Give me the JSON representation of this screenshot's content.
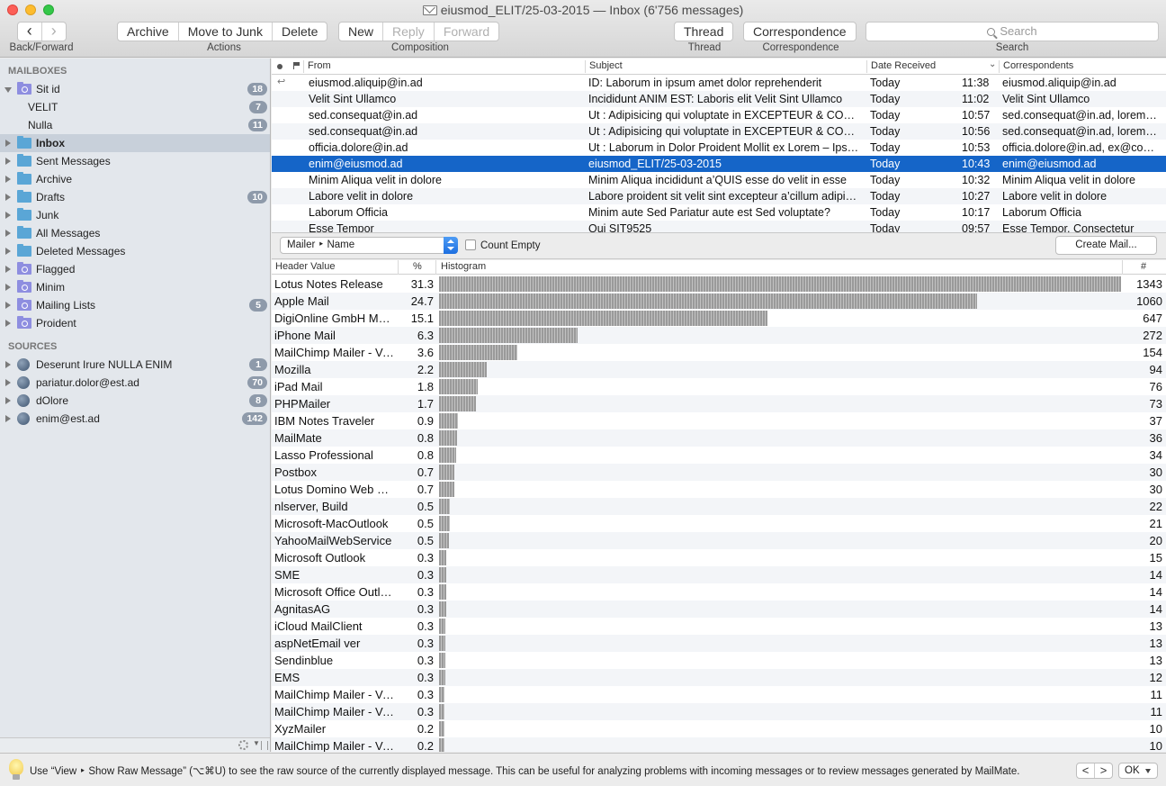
{
  "window": {
    "title": "eiusmod_ELIT/25-03-2015 — Inbox (6'756 messages)"
  },
  "toolbar": {
    "back_icon": "‹",
    "forward_icon": "›",
    "back_forward_caption": "Back/Forward",
    "actions": [
      "Archive",
      "Move to Junk",
      "Delete"
    ],
    "actions_caption": "Actions",
    "composition": [
      "New",
      "Reply",
      "Forward"
    ],
    "composition_caption": "Composition",
    "thread_label": "Thread",
    "thread_caption": "Thread",
    "correspondence_label": "Correspondence",
    "correspondence_caption": "Correspondence",
    "search_placeholder": "Search",
    "search_caption": "Search"
  },
  "sidebar": {
    "mailboxes_header": "MAILBOXES",
    "mailboxes": [
      {
        "label": "Sit id",
        "badge": "18",
        "icon": "smart-folder-icon",
        "expanded": true
      },
      {
        "label": "VELIT",
        "badge": "7",
        "icon": "none",
        "indent": true
      },
      {
        "label": "Nulla",
        "badge": "11",
        "icon": "none",
        "indent": true
      },
      {
        "label": "Inbox",
        "badge": "",
        "icon": "folder-icon",
        "selected": true
      },
      {
        "label": "Sent Messages",
        "badge": "",
        "icon": "folder-icon"
      },
      {
        "label": "Archive",
        "badge": "",
        "icon": "folder-icon"
      },
      {
        "label": "Drafts",
        "badge": "10",
        "icon": "folder-icon"
      },
      {
        "label": "Junk",
        "badge": "",
        "icon": "folder-icon"
      },
      {
        "label": "All Messages",
        "badge": "",
        "icon": "folder-icon"
      },
      {
        "label": "Deleted Messages",
        "badge": "",
        "icon": "folder-icon"
      },
      {
        "label": "Flagged",
        "badge": "",
        "icon": "smart-folder-icon"
      },
      {
        "label": "Minim",
        "badge": "",
        "icon": "smart-folder-icon"
      },
      {
        "label": "Mailing Lists",
        "badge": "5",
        "icon": "smart-folder-icon"
      },
      {
        "label": "Proident",
        "badge": "",
        "icon": "smart-folder-icon"
      }
    ],
    "sources_header": "SOURCES",
    "sources": [
      {
        "label": "Deserunt Irure NULLA ENIM",
        "badge": "1"
      },
      {
        "label": "pariatur.dolor@est.ad",
        "badge": "70"
      },
      {
        "label": "dOlore",
        "badge": "8"
      },
      {
        "label": "enim@est.ad",
        "badge": "142"
      }
    ]
  },
  "message_list": {
    "columns": {
      "from": "From",
      "subject": "Subject",
      "date": "Date Received",
      "correspondents": "Correspondents"
    },
    "rows": [
      {
        "from": "eiusmod.aliquip@in.ad",
        "subject": "ID: Laborum in ipsum amet dolor reprehenderit",
        "date": "Today",
        "time": "11:38",
        "correspondents": "eiusmod.aliquip@in.ad",
        "replied": true
      },
      {
        "from": "Velit Sint Ullamco",
        "subject": "Incididunt ANIM EST: Laboris elit Velit Sint Ullamco",
        "date": "Today",
        "time": "11:02",
        "correspondents": "Velit Sint Ullamco"
      },
      {
        "from": "sed.consequat@in.ad",
        "subject": "Ut : Adipisicing qui voluptate in EXCEPTEUR & CONSEQUAT",
        "date": "Today",
        "time": "10:57",
        "correspondents": "sed.consequat@in.ad, lorem@in.ad"
      },
      {
        "from": "sed.consequat@in.ad",
        "subject": "Ut : Adipisicing qui voluptate in EXCEPTEUR & CONSEQUAT",
        "date": "Today",
        "time": "10:56",
        "correspondents": "sed.consequat@in.ad, lorem@in.ad"
      },
      {
        "from": "officia.dolore@in.ad",
        "subject": "Ut : Laborum in Dolor Proident Mollit ex Lorem – Ipsum",
        "date": "Today",
        "time": "10:53",
        "correspondents": "officia.dolore@in.ad, ex@commodo.ad"
      },
      {
        "from": "enim@eiusmod.ad",
        "subject": "eiusmod_ELIT/25-03-2015",
        "date": "Today",
        "time": "10:43",
        "correspondents": "enim@eiusmod.ad",
        "selected": true
      },
      {
        "from": "Minim Aliqua velit in dolore",
        "subject": "Minim Aliqua incididunt a’QUIS esse do velit in esse",
        "date": "Today",
        "time": "10:32",
        "correspondents": "Minim Aliqua velit in dolore"
      },
      {
        "from": "Labore velit in dolore",
        "subject": "Labore proident sit velit sint excepteur a’cillum adipisicing",
        "date": "Today",
        "time": "10:27",
        "correspondents": "Labore velit in dolore"
      },
      {
        "from": "Laborum Officia",
        "subject": "Minim aute Sed Pariatur aute est Sed voluptate?",
        "date": "Today",
        "time": "10:17",
        "correspondents": "Laborum Officia"
      },
      {
        "from": "Esse Tempor",
        "subject": "Qui SIT9525",
        "date": "Today",
        "time": "09:57",
        "correspondents": "Esse Tempor, Consectetur"
      }
    ]
  },
  "histogram_bar": {
    "header_popup": "Mailer ‣ Name",
    "count_empty_label": "Count Empty",
    "count_empty_checked": false,
    "create_mail_label": "Create Mail..."
  },
  "histogram": {
    "columns": {
      "value": "Header Value",
      "pct": "%",
      "hist": "Histogram",
      "count": "#"
    },
    "rows": [
      {
        "name": "Lotus Notes Release",
        "pct": "31.3",
        "count": 1343
      },
      {
        "name": "Apple Mail",
        "pct": "24.7",
        "count": 1060
      },
      {
        "name": "DigiOnline GmbH Mailer",
        "pct": "15.1",
        "count": 647
      },
      {
        "name": "iPhone Mail",
        "pct": "6.3",
        "count": 272
      },
      {
        "name": "MailChimp Mailer - Version",
        "pct": "3.6",
        "count": 154
      },
      {
        "name": "Mozilla",
        "pct": "2.2",
        "count": 94
      },
      {
        "name": "iPad Mail",
        "pct": "1.8",
        "count": 76
      },
      {
        "name": "PHPMailer",
        "pct": "1.7",
        "count": 73
      },
      {
        "name": "IBM Notes Traveler",
        "pct": "0.9",
        "count": 37
      },
      {
        "name": "MailMate",
        "pct": "0.8",
        "count": 36
      },
      {
        "name": "Lasso Professional",
        "pct": "0.8",
        "count": 34
      },
      {
        "name": "Postbox",
        "pct": "0.7",
        "count": 30
      },
      {
        "name": "Lotus Domino Web Server",
        "pct": "0.7",
        "count": 30
      },
      {
        "name": "nlserver, Build",
        "pct": "0.5",
        "count": 22
      },
      {
        "name": "Microsoft-MacOutlook",
        "pct": "0.5",
        "count": 21
      },
      {
        "name": "YahooMailWebService",
        "pct": "0.5",
        "count": 20
      },
      {
        "name": "Microsoft Outlook",
        "pct": "0.3",
        "count": 15
      },
      {
        "name": "SME",
        "pct": "0.3",
        "count": 14
      },
      {
        "name": "Microsoft Office Outlook",
        "pct": "0.3",
        "count": 14
      },
      {
        "name": "AgnitasAG",
        "pct": "0.3",
        "count": 14
      },
      {
        "name": "iCloud MailClient",
        "pct": "0.3",
        "count": 13
      },
      {
        "name": "aspNetEmail ver",
        "pct": "0.3",
        "count": 13
      },
      {
        "name": "Sendinblue",
        "pct": "0.3",
        "count": 13
      },
      {
        "name": "EMS",
        "pct": "0.3",
        "count": 12
      },
      {
        "name": "MailChimp Mailer - Version",
        "pct": "0.3",
        "count": 11
      },
      {
        "name": "MailChimp Mailer - Version",
        "pct": "0.3",
        "count": 11
      },
      {
        "name": "XyzMailer",
        "pct": "0.2",
        "count": 10
      },
      {
        "name": "MailChimp Mailer - Version",
        "pct": "0.2",
        "count": 10
      }
    ]
  },
  "tip": {
    "text": "Use “View ‣ Show Raw Message” (⌥⌘U) to see the raw source of the currently displayed message. This can be useful for analyzing problems with incoming messages or to review messages generated by MailMate.",
    "prev": "<",
    "next": ">",
    "ok_label": "OK"
  }
}
